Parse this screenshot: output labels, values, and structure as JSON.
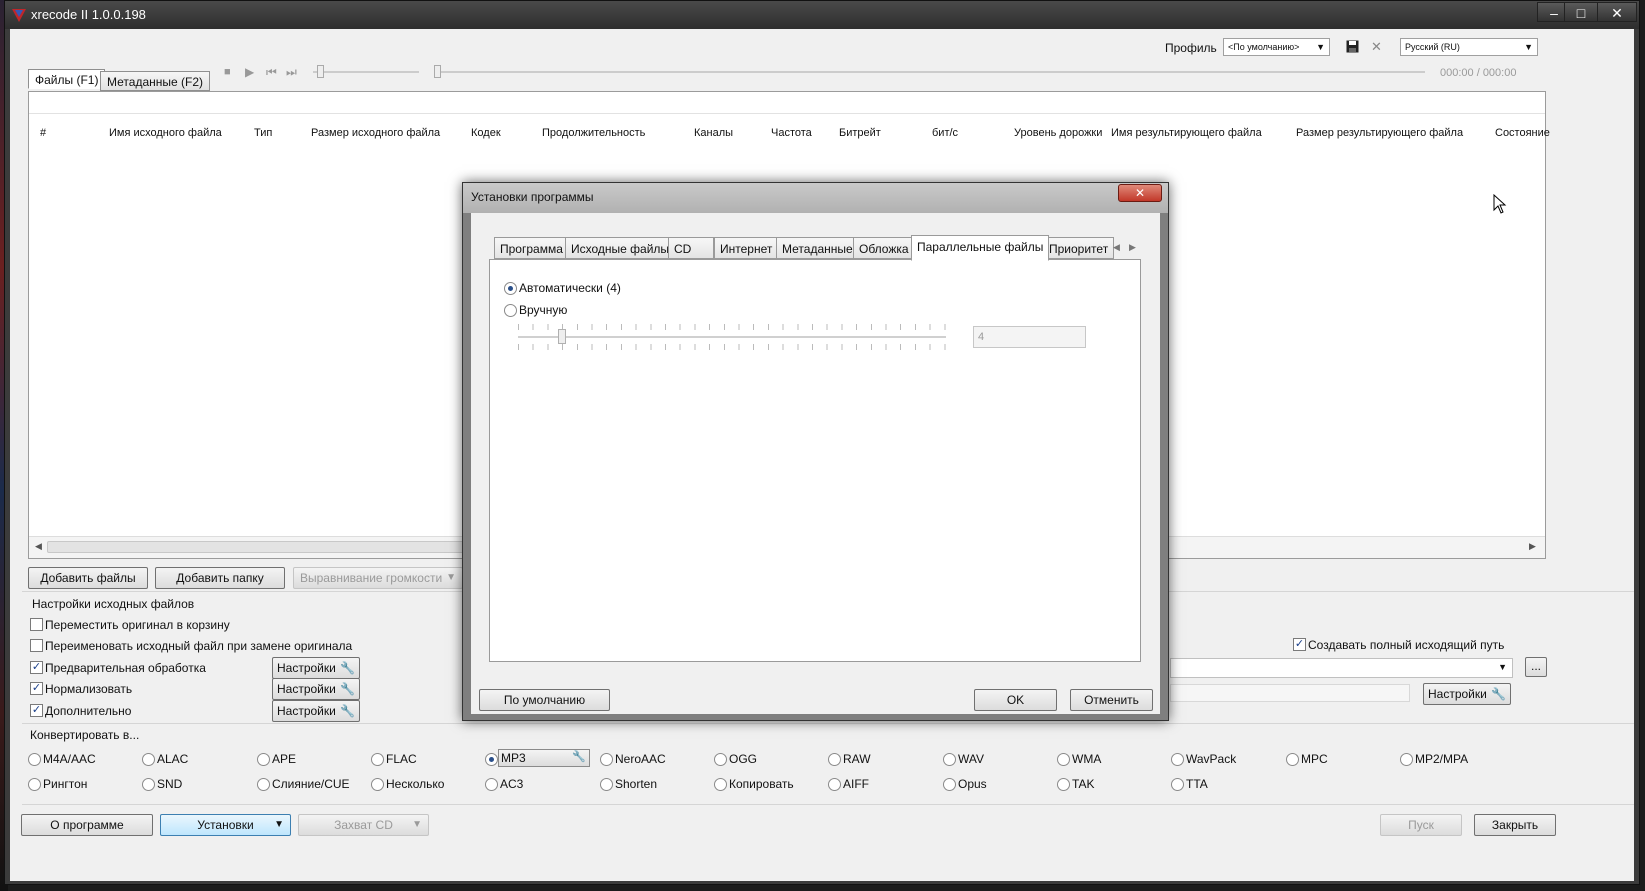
{
  "window": {
    "title": "xrecode II 1.0.0.198",
    "min": "‒",
    "max": "□",
    "close": "✕"
  },
  "toolbar": {
    "profile_label": "Профиль",
    "profile_value": "<По умолчанию>",
    "language_value": "Русский (RU)",
    "time": "000:00 / 000:00"
  },
  "tabs": [
    "Файлы (F1)",
    "Метаданные (F2)"
  ],
  "columns": [
    "#",
    "Имя исходного файла",
    "Тип",
    "Размер исходного файла",
    "Кодек",
    "Продолжительность",
    "Каналы",
    "Частота",
    "Битрейт",
    "бит/с",
    "Уровень дорожки",
    "Имя результирующего файла",
    "Размер результирующего файла",
    "Состояние"
  ],
  "buttons": {
    "add_files": "Добавить файлы",
    "add_folder": "Добавить папку",
    "normalize_volume": "Выравнивание громкости",
    "settings": "Настройки",
    "about": "О программе",
    "setup": "Установки",
    "cd_grab": "Захват CD",
    "start": "Пуск",
    "close": "Закрыть",
    "browse": "..."
  },
  "source_settings": {
    "title": "Настройки исходных файлов",
    "items": [
      {
        "label": "Переместить оригинал в корзину",
        "checked": false
      },
      {
        "label": "Переименовать исходный файл при замене оригинала",
        "checked": false
      },
      {
        "label": "Предварительная обработка",
        "checked": true
      },
      {
        "label": "Нормализовать",
        "checked": true
      },
      {
        "label": "Дополнительно",
        "checked": true
      }
    ]
  },
  "output": {
    "full_path_label": "Создавать полный исходящий путь",
    "full_path_checked": true
  },
  "convert": {
    "title": "Конвертировать в...",
    "row1": [
      "M4A/AAC",
      "ALAC",
      "APE",
      "FLAC",
      "MP3",
      "NeroAAC",
      "OGG",
      "RAW",
      "WAV",
      "WMA",
      "WavPack",
      "MPC",
      "MP2/MPA"
    ],
    "row2": [
      "Рингтон",
      "SND",
      "Слияние/CUE",
      "Несколько",
      "AC3",
      "Shorten",
      "Копировать",
      "AIFF",
      "Opus",
      "TAK",
      "TTA"
    ],
    "selected": "MP3"
  },
  "dialog": {
    "title": "Установки программы",
    "close": "✕",
    "tabs": [
      "Программа",
      "Исходные файлы",
      "CD",
      "Интернет",
      "Метаданные",
      "Обложка",
      "Параллельные файлы",
      "Приоритет"
    ],
    "active_tab": "Параллельные файлы",
    "auto_label": "Автоматически (4)",
    "manual_label": "Вручную",
    "slider_value": "4",
    "default_btn": "По умолчанию",
    "ok_btn": "OK",
    "cancel_btn": "Отменить"
  }
}
